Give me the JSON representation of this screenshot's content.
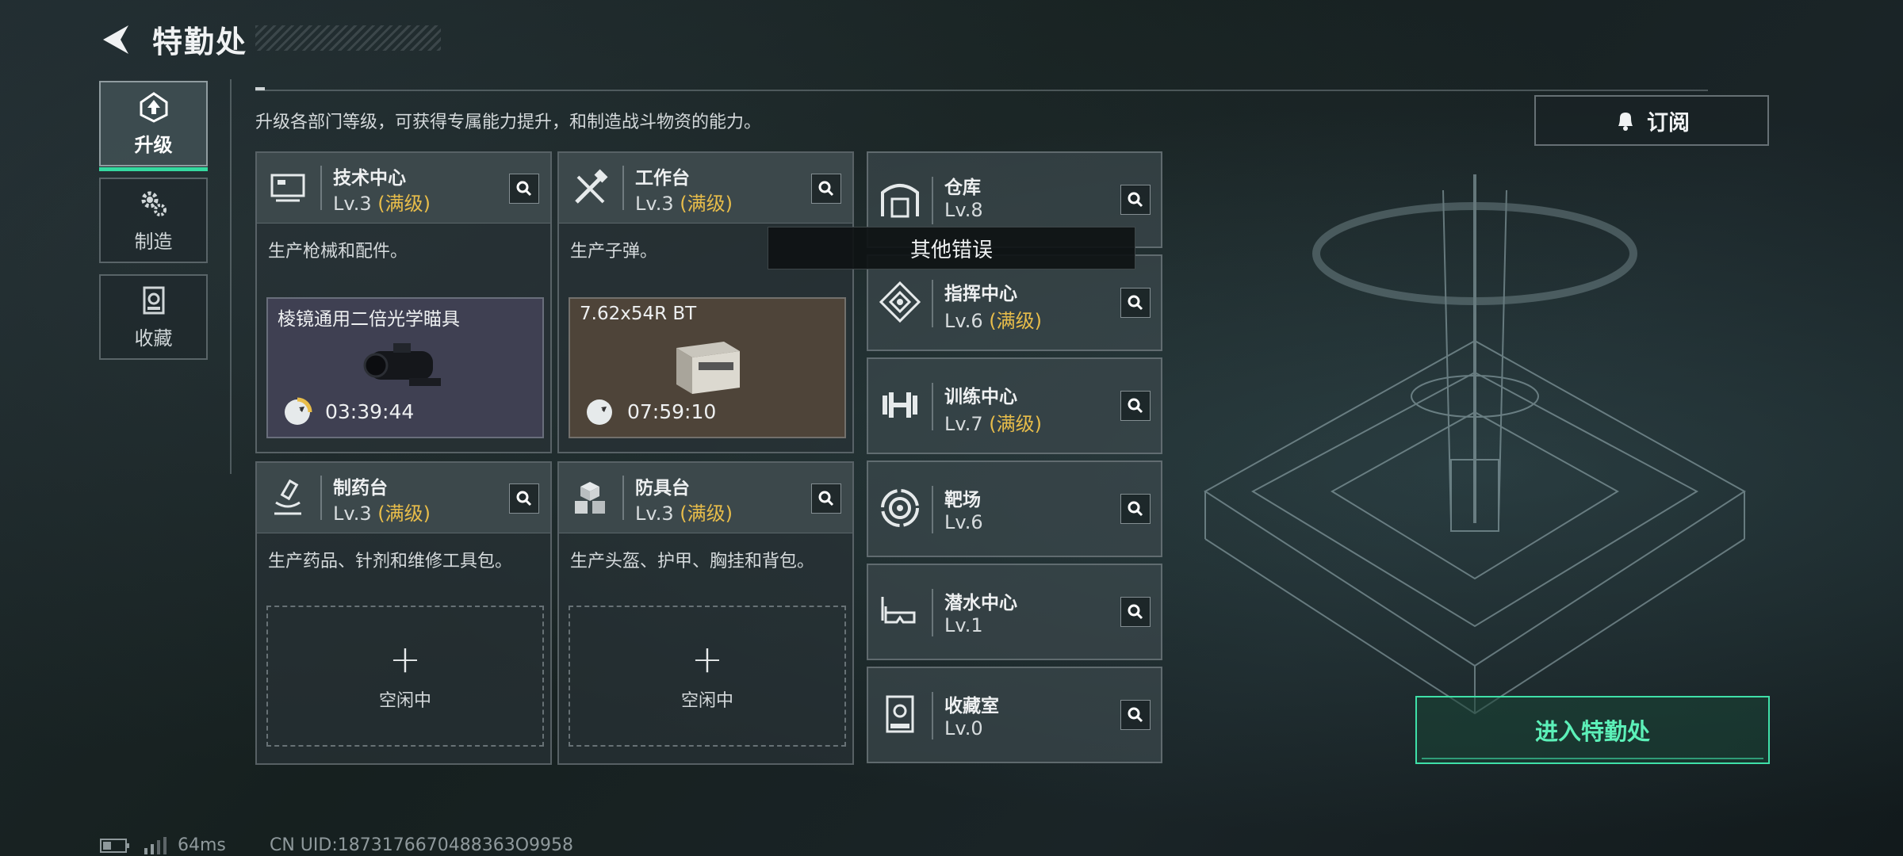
{
  "header": {
    "title": "特勤处"
  },
  "nav": [
    {
      "label": "升级",
      "icon": "upgrade-icon",
      "active": true
    },
    {
      "label": "制造",
      "icon": "gear-icon",
      "active": false
    },
    {
      "label": "收藏",
      "icon": "collection-icon",
      "active": false
    }
  ],
  "description": "升级各部门等级，可获得专属能力提升，和制造战斗物资的能力。",
  "subscribe": {
    "label": "订阅",
    "icon": "bell-icon"
  },
  "cards": [
    {
      "name": "技术中心",
      "level": "Lv.3",
      "max": "(满级)",
      "desc": "生产枪械和配件。",
      "product": {
        "name": "棱镜通用二倍光学瞄具",
        "time": "03:39:44",
        "bg": "#3f4052"
      }
    },
    {
      "name": "工作台",
      "level": "Lv.3",
      "max": "(满级)",
      "desc": "生产子弹。",
      "product": {
        "name": "7.62x54R BT",
        "time": "07:59:10",
        "bg": "#4e4439"
      }
    },
    {
      "name": "制药台",
      "level": "Lv.3",
      "max": "(满级)",
      "desc": "生产药品、针剂和维修工具包。",
      "empty": "空闲中"
    },
    {
      "name": "防具台",
      "level": "Lv.3",
      "max": "(满级)",
      "desc": "生产头盔、护甲、胸挂和背包。",
      "empty": "空闲中"
    }
  ],
  "small_cards": [
    {
      "name": "仓库",
      "level": "Lv.8",
      "max": ""
    },
    {
      "name": "指挥中心",
      "level": "Lv.6",
      "max": "(满级)"
    },
    {
      "name": "训练中心",
      "level": "Lv.7",
      "max": "(满级)"
    },
    {
      "name": "靶场",
      "level": "Lv.6",
      "max": ""
    },
    {
      "name": "潜水中心",
      "level": "Lv.1",
      "max": ""
    },
    {
      "name": "收藏室",
      "level": "Lv.0",
      "max": ""
    }
  ],
  "tooltip": "其他错误",
  "enter_button": "进入特勤处",
  "footer": {
    "ping": "64ms",
    "uid": "CN UID:1873176670488363O9958"
  },
  "colors": {
    "accent": "#3fe0a8",
    "max_level": "#e8bd4a"
  }
}
